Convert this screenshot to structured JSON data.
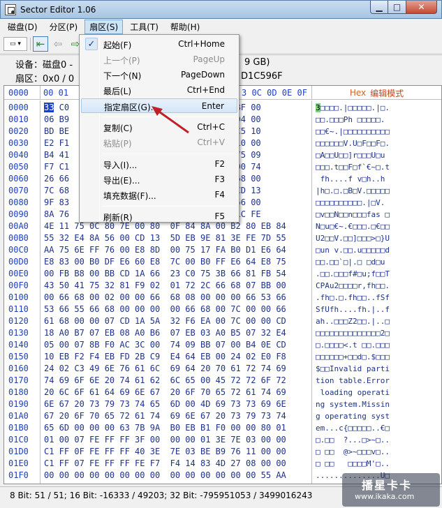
{
  "window": {
    "title": "Sector Editor 1.06",
    "min": "0",
    "max": "1",
    "close": "r"
  },
  "menubar": {
    "items": [
      "磁盘(D)",
      "分区(P)",
      "扇区(S)",
      "工具(T)",
      "帮助(H)"
    ]
  },
  "toolbar": {
    "dropdown_icon": "drive-icon",
    "nav_icons": [
      "first-icon",
      "back-icon",
      "forward-icon"
    ]
  },
  "info": {
    "device_label": "设备：磁盘0 -",
    "device_suffix": "9 GB)",
    "partition_label": "扇区：0x0 / 0",
    "partition_suffix": "D1C596F"
  },
  "editor": {
    "offset_header": "0000",
    "col_header_left": "00 01",
    "col_header_right": "3 0C 0D 0E 0F",
    "hex_mode_label": "Hex",
    "hex_mode_title": "编辑模式",
    "rows": [
      {
        "off": "0000",
        "hex": "33 C0                         E 00 7C BF 00",
        "asc": "3□□□□.|□□□□□.|□."
      },
      {
        "off": "0010",
        "hex": "06 B9                         3 FB B9 04 00",
        "asc": "□□.□□□Ph □□□□□."
      },
      {
        "off": "0020",
        "hex": "BD BE                         E 01 83 C5 10",
        "asc": "□□€~.|□□□□□□□□□□"
      },
      {
        "off": "0030",
        "hex": "E2 F1                         5 C6 46 10 00",
        "asc": "□□□□□□V.U□F□□F□."
      },
      {
        "off": "0040",
        "hex": "B4 41                         3 55 AA 75 09",
        "asc": "□A□□U□□]r□□□U□u"
      },
      {
        "off": "0050",
        "hex": "F7 C1                         0 7E 10 00 74",
        "asc": "□□□.t□□F□f`€~□.t"
      },
      {
        "off": "0060",
        "hex": "26 66                         3 00 00 68 00",
        "asc": " fh....f v□h..h"
      },
      {
        "off": "0070",
        "hex": "7C 68                         3 8B F4 CD 13",
        "asc": "|h□.□.□B□V.□□□□□"
      },
      {
        "off": "0080",
        "hex": "9F 83                         0 7C 8A 56 00",
        "asc": "□□□□□□□□□□.|□V."
      },
      {
        "off": "0090",
        "hex": "8A 76                         E 61 73 1C FE",
        "asc": "□v□□N□□n□□□fas □"
      },
      {
        "off": "00A0",
        "hex": "4E 11 75 0C 80 7E 00 80  0F 84 8A 00 B2 80 EB 84",
        "asc": "N□u□€~.€□□□.□€□□"
      },
      {
        "off": "00B0",
        "hex": "55 32 E4 8A 56 00 CD 13  5D EB 9E 81 3E FE 7D 55",
        "asc": "U2□□V.□□]□□□>□}U"
      },
      {
        "off": "00C0",
        "hex": "AA 75 6E FF 76 00 E8 8D  00 75 17 FA B0 D1 E6 64",
        "asc": "□un v.□□.u□□□□□d"
      },
      {
        "off": "00D0",
        "hex": "E8 83 00 B0 DF E6 60 E8  7C 00 B0 FF E6 64 E8 75",
        "asc": "□□.□□`□|.□ □d□u"
      },
      {
        "off": "00E0",
        "hex": "00 FB B8 00 BB CD 1A 66  23 C0 75 3B 66 81 FB 54",
        "asc": ".□□.□□□f#□u;f□□T"
      },
      {
        "off": "00F0",
        "hex": "43 50 41 75 32 81 F9 02  01 72 2C 66 68 07 BB 00",
        "asc": "CPAu2□□□□r,fh□□."
      },
      {
        "off": "0100",
        "hex": "00 66 68 00 02 00 00 66  68 08 00 00 00 66 53 66",
        "asc": ".fh□.□.fh□□..fSf"
      },
      {
        "off": "0110",
        "hex": "53 66 55 66 68 00 00 00  00 66 68 00 7C 00 00 66",
        "asc": "SfUfh....fh.|..f"
      },
      {
        "off": "0120",
        "hex": "61 68 00 00 07 CD 1A 5A  32 F6 EA 00 7C 00 00 CD",
        "asc": "ah..□□□Z2□□.|..□"
      },
      {
        "off": "0130",
        "hex": "18 A0 B7 07 EB 08 A0 B6  07 EB 03 A0 B5 07 32 E4",
        "asc": "□□□□□□□□□□□□□□2□"
      },
      {
        "off": "0140",
        "hex": "05 00 07 8B F0 AC 3C 00  74 09 BB 07 00 B4 0E CD",
        "asc": "□.□□□□<.t □□.□□□"
      },
      {
        "off": "0150",
        "hex": "10 EB F2 F4 EB FD 2B C9  E4 64 EB 00 24 02 E0 F8",
        "asc": "□□□□□□+□□d□.$□□□"
      },
      {
        "off": "0160",
        "hex": "24 02 C3 49 6E 76 61 6C  69 64 20 70 61 72 74 69",
        "asc": "$□□Invalid parti"
      },
      {
        "off": "0170",
        "hex": "74 69 6F 6E 20 74 61 62  6C 65 00 45 72 72 6F 72",
        "asc": "tion table.Error"
      },
      {
        "off": "0180",
        "hex": "20 6C 6F 61 64 69 6E 67  20 6F 70 65 72 61 74 69",
        "asc": " loading operati"
      },
      {
        "off": "0190",
        "hex": "6E 67 20 73 79 73 74 65  6D 00 4D 69 73 73 69 6E",
        "asc": "ng system.Missin"
      },
      {
        "off": "01A0",
        "hex": "67 20 6F 70 65 72 61 74  69 6E 67 20 73 79 73 74",
        "asc": "g operating syst"
      },
      {
        "off": "01B0",
        "hex": "65 6D 00 00 00 63 7B 9A  B0 EB B1 F0 00 00 80 01",
        "asc": "em...c{□□□□□..€□"
      },
      {
        "off": "01C0",
        "hex": "01 00 07 FE FF FF 3F 00  00 00 01 3E 7E 03 00 00",
        "asc": "□.□□  ?...□>~□.."
      },
      {
        "off": "01D0",
        "hex": "C1 FF 0F FE FF FF 40 3E  7E 03 BE B9 76 11 00 00",
        "asc": "□ □□  @>~□□□v□.."
      },
      {
        "off": "01E0",
        "hex": "C1 FF 07 FE FF FF FE F7  F4 14 83 4D 27 08 00 00",
        "asc": "□ □□   □□□□M'□.."
      },
      {
        "off": "01F0",
        "hex": "00 00 00 00 00 00 00 00  00 00 00 00 00 00 55 AA",
        "asc": "..............U□"
      }
    ]
  },
  "sector_menu": {
    "items": [
      {
        "label": "起始(F)",
        "shortcut": "Ctrl+Home",
        "checked": true,
        "disabled": false,
        "hl": false
      },
      {
        "label": "上一个(P)",
        "shortcut": "PageUp",
        "checked": false,
        "disabled": true,
        "hl": false
      },
      {
        "label": "下一个(N)",
        "shortcut": "PageDown",
        "checked": false,
        "disabled": false,
        "hl": false
      },
      {
        "label": "最后(L)",
        "shortcut": "Ctrl+End",
        "checked": false,
        "disabled": false,
        "hl": false
      },
      {
        "label": "指定扇区(G)...",
        "shortcut": "Enter",
        "checked": false,
        "disabled": false,
        "hl": true
      },
      {
        "label": "复制(C)",
        "shortcut": "Ctrl+C",
        "checked": false,
        "disabled": false,
        "hl": false
      },
      {
        "label": "粘贴(P)",
        "shortcut": "Ctrl+V",
        "checked": false,
        "disabled": true,
        "hl": false
      },
      {
        "label": "导入(I)...",
        "shortcut": "F2",
        "checked": false,
        "disabled": false,
        "hl": false
      },
      {
        "label": "导出(E)...",
        "shortcut": "F3",
        "checked": false,
        "disabled": false,
        "hl": false
      },
      {
        "label": "填充数据(F)...",
        "shortcut": "F4",
        "checked": false,
        "disabled": false,
        "hl": false
      },
      {
        "label": "刷新(R)",
        "shortcut": "F5",
        "checked": false,
        "disabled": false,
        "hl": false
      }
    ]
  },
  "status": {
    "text": "8 Bit: 51 / 51;  16 Bit: -16333 / 49203;  32 Bit: -795951053 / 3499016243"
  },
  "watermark": {
    "line1": "播星卡卡",
    "line2": "www.ikaka.com"
  },
  "colors": {
    "offset_blue": "#1c3fc4",
    "hex_text": "#1e3288",
    "hex_header_orange": "#d2601a",
    "arrow_red": "#c0202a"
  }
}
